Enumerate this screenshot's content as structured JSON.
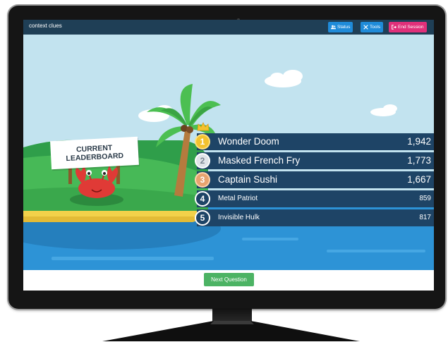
{
  "app": {
    "title": "context clues"
  },
  "toolbar": {
    "status_label": "Status",
    "tools_label": "Tools",
    "end_label": "End Session"
  },
  "sign": {
    "line1": "CURRENT",
    "line2": "LEADERBOARD"
  },
  "leaderboard": [
    {
      "rank": "1",
      "name": "Wonder Doom",
      "score": "1,942"
    },
    {
      "rank": "2",
      "name": "Masked French Fry",
      "score": "1,773"
    },
    {
      "rank": "3",
      "name": "Captain Sushi",
      "score": "1,667"
    },
    {
      "rank": "4",
      "name": "Metal Patriot",
      "score": "859"
    },
    {
      "rank": "5",
      "name": "Invisible Hulk",
      "score": "817"
    }
  ],
  "bottom": {
    "next_label": "Next Question"
  },
  "colors": {
    "topbar": "#1f3f56",
    "button_blue": "#1f8bd9",
    "button_pink": "#e0307a",
    "row_bg": "#1e4466",
    "next_green": "#4cb364",
    "sky": "#c2e3ef",
    "sea": "#2d93d6"
  },
  "icons": {
    "status": "users-icon",
    "tools": "tools-icon",
    "end": "sign-out-icon",
    "crown": "crown-icon"
  }
}
